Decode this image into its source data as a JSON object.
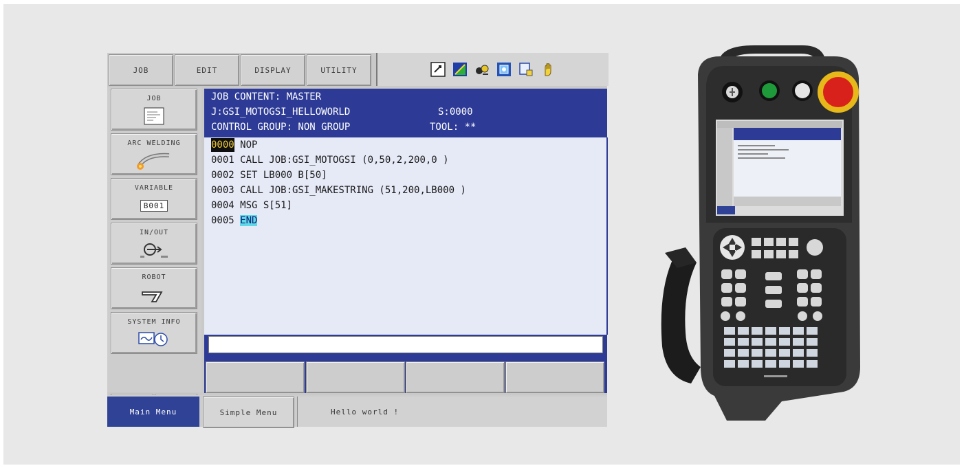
{
  "top_menu": [
    {
      "label": "JOB"
    },
    {
      "label": "EDIT"
    },
    {
      "label": "DISPLAY"
    },
    {
      "label": "UTILITY"
    }
  ],
  "status_icons": [
    "edit-mode-icon",
    "signal-level-icon",
    "running-robot-icon",
    "teach-mode-icon",
    "page-icon",
    "hand-icon"
  ],
  "side_menu": {
    "job": "JOB",
    "arc_welding": "ARC WELDING",
    "variable": "VARIABLE",
    "variable_value": "B001",
    "in_out": "IN/OUT",
    "robot": "ROBOT",
    "system_info": "SYSTEM INFO"
  },
  "job_header": {
    "title": "JOB CONTENT: MASTER",
    "job_name": "J:GSI_MOTOGSI_HELLOWORLD",
    "step": "S:0000",
    "control_group": "CONTROL GROUP: NON GROUP",
    "tool": "TOOL: **"
  },
  "job_lines": [
    {
      "num": "0000",
      "text": " NOP"
    },
    {
      "num": "0001",
      "text": " CALL JOB:GSI_MOTOGSI (0,50,2,200,0 )"
    },
    {
      "num": "0002",
      "text": " SET LB000 B[50]"
    },
    {
      "num": "0003",
      "text": " CALL JOB:GSI_MAKESTRING (51,200,LB000 )"
    },
    {
      "num": "0004",
      "text": " MSG S[51]"
    },
    {
      "num": "0005",
      "text": " ",
      "end_keyword": "END"
    }
  ],
  "bottom_bar": {
    "main_menu": "Main Menu",
    "simple_menu": "Simple Menu",
    "message": "Hello world !"
  },
  "colors": {
    "header_blue": "#2d3b96",
    "body_bg": "#e6e9f6",
    "selected_line_num": "#f2cf3a",
    "end_highlight": "#5fd9e8",
    "estop_red": "#d9211c",
    "green_button": "#1f9a3a"
  }
}
